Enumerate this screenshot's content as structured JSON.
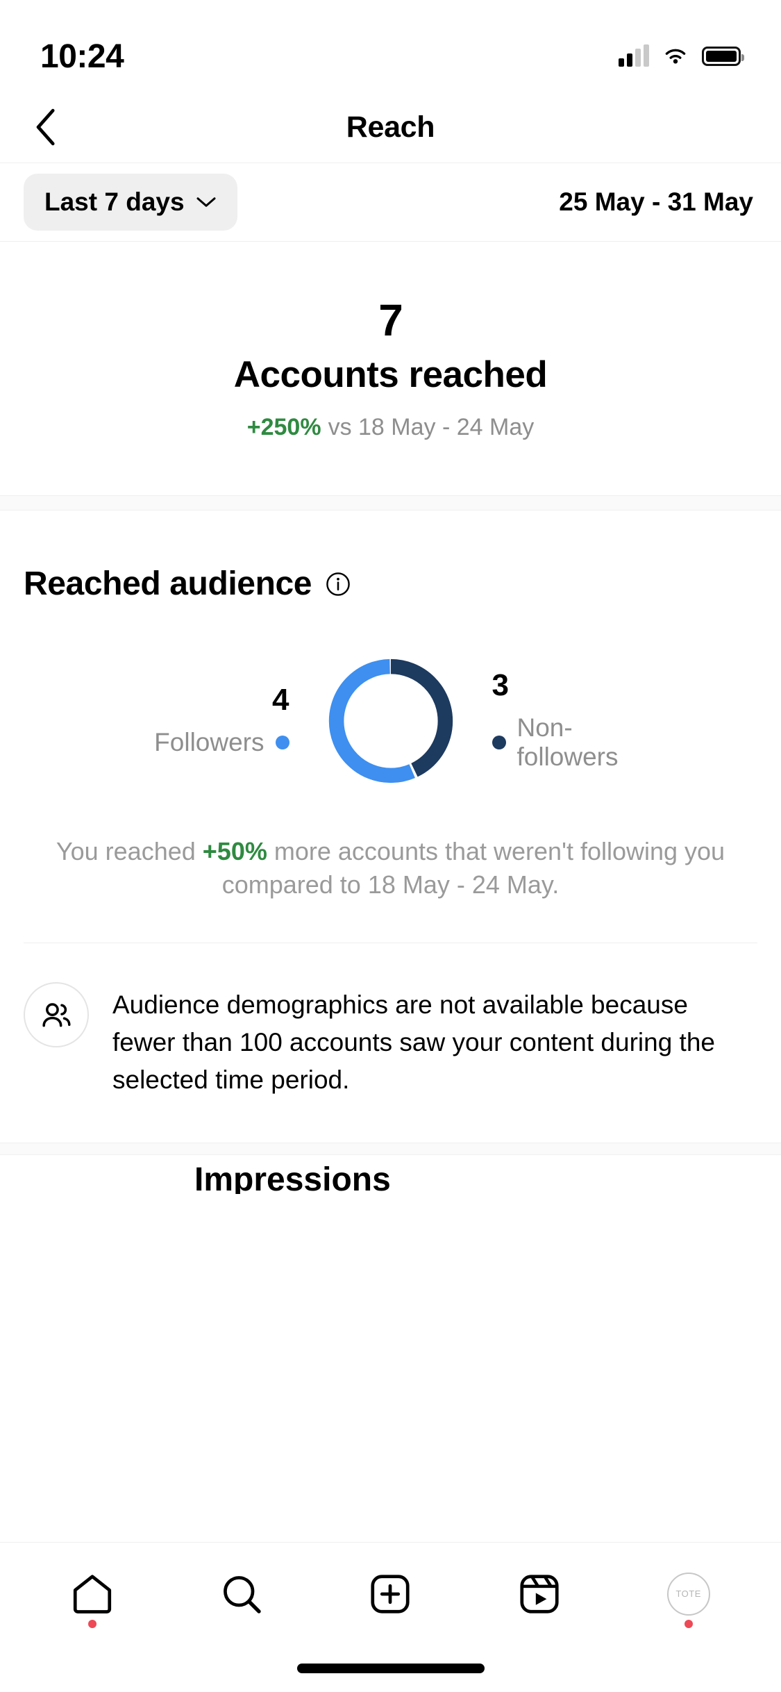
{
  "status_bar": {
    "time": "10:24",
    "signal_icon": "cellular-signal-icon",
    "wifi_icon": "wifi-icon",
    "battery_icon": "battery-icon"
  },
  "nav": {
    "back_icon": "back-chevron-icon",
    "title": "Reach"
  },
  "filter": {
    "range_label": "Last 7 days",
    "chevron_icon": "chevron-down-icon",
    "date_range": "25 May - 31 May"
  },
  "summary": {
    "value": "7",
    "label": "Accounts reached",
    "change": "+250%",
    "comparison": "vs 18 May - 24 May"
  },
  "audience": {
    "title": "Reached audience",
    "info_icon": "info-icon",
    "note_prefix": "You reached ",
    "note_change": "+50%",
    "note_suffix": " more accounts that weren't following you compared to 18 May - 24 May."
  },
  "demographics": {
    "icon": "people-icon",
    "message": "Audience demographics are not available because fewer than 100 accounts saw your content during the selected time period."
  },
  "next_section": {
    "partial_title": "Impressions"
  },
  "tab_bar": {
    "items": [
      {
        "name": "home",
        "icon": "home-icon",
        "has_badge_dot": true
      },
      {
        "name": "search",
        "icon": "search-icon",
        "has_badge_dot": false
      },
      {
        "name": "create",
        "icon": "plus-square-icon",
        "has_badge_dot": false
      },
      {
        "name": "reels",
        "icon": "reels-icon",
        "has_badge_dot": false
      },
      {
        "name": "profile",
        "icon": "avatar-icon",
        "has_badge_dot": true,
        "avatar_text": "TOTE"
      }
    ]
  },
  "colors": {
    "followers": "#3E8FEF",
    "non_followers": "#1D3A5F",
    "positive": "#2f8a41",
    "muted": "#8e8e8e",
    "badge_dot": "#ed4956"
  },
  "chart_data": {
    "type": "pie",
    "title": "Reached audience",
    "subtype": "donut",
    "categories": [
      "Followers",
      "Non-followers"
    ],
    "values": [
      4,
      3
    ],
    "total": 7,
    "units": "accounts",
    "colors": [
      "#3E8FEF",
      "#1D3A5F"
    ],
    "legend": "left and right of donut",
    "percentages": [
      57.1,
      42.9
    ],
    "start_angle_deg": 0,
    "gap_deg": 3,
    "annotations": [
      "You reached +50% more accounts that weren't following you compared to 18 May - 24 May."
    ]
  }
}
